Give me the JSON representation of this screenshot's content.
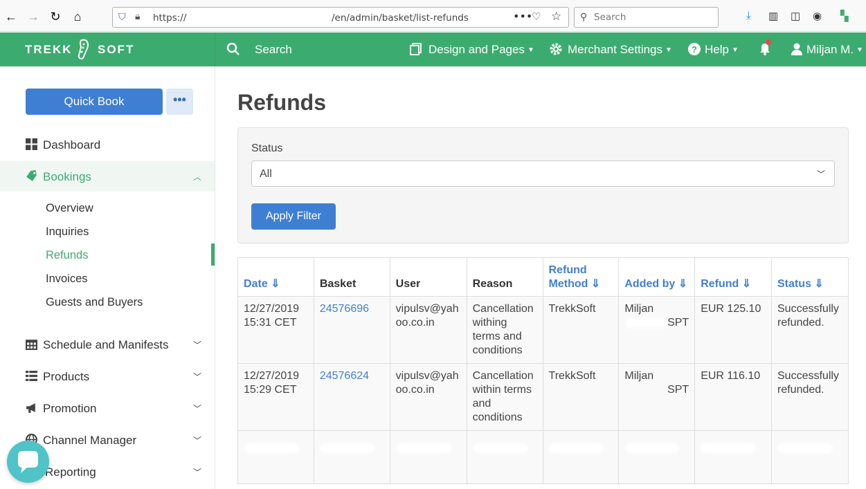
{
  "browser": {
    "url_scheme": "https://",
    "url_path": "/en/admin/basket/list-refunds",
    "search_placeholder": "Search"
  },
  "header": {
    "brand_left": "TREKK",
    "brand_right": "SOFT",
    "search_label": "Search",
    "design_pages": "Design and Pages",
    "merchant_settings": "Merchant Settings",
    "help": "Help",
    "user": "Miljan M."
  },
  "sidebar": {
    "quick_book": "Quick Book",
    "more": "•••",
    "items": [
      {
        "label": "Dashboard"
      },
      {
        "label": "Bookings"
      },
      {
        "label": "Schedule and Manifests"
      },
      {
        "label": "Products"
      },
      {
        "label": "Promotion"
      },
      {
        "label": "Channel Manager"
      },
      {
        "label": "Reporting"
      }
    ],
    "sub_items": [
      "Overview",
      "Inquiries",
      "Refunds",
      "Invoices",
      "Guests and Buyers"
    ]
  },
  "main": {
    "title": "Refunds",
    "filter": {
      "status_label": "Status",
      "status_value": "All",
      "apply_label": "Apply Filter"
    },
    "table": {
      "headers": {
        "date": "Date ⇓",
        "basket": "Basket",
        "user": "User",
        "reason": "Reason",
        "refund_method_1": "Refund",
        "refund_method_2": "Method ⇓",
        "added_by": "Added by ⇓",
        "refund": "Refund ⇓",
        "status": "Status ⇓"
      },
      "rows": [
        {
          "date1": "12/27/2019",
          "date2": "15:31 CET",
          "basket": "24576696",
          "user1": "vipulsv@yah",
          "user2": "oo.co.in",
          "reason": [
            "Cancellation",
            "withing",
            "terms and",
            "conditions"
          ],
          "method": "TrekkSoft",
          "added1": "Miljan",
          "added2": "SPT",
          "refund": "EUR 125.10",
          "status1": "Successfully",
          "status2": "refunded."
        },
        {
          "date1": "12/27/2019",
          "date2": "15:29 CET",
          "basket": "24576624",
          "user1": "vipulsv@yah",
          "user2": "oo.co.in",
          "reason": [
            "Cancellation",
            "within terms",
            "and",
            "conditions"
          ],
          "method": "TrekkSoft",
          "added1": "Miljan",
          "added2": "SPT",
          "refund": "EUR 116.10",
          "status1": "Successfully",
          "status2": "refunded."
        }
      ]
    }
  }
}
